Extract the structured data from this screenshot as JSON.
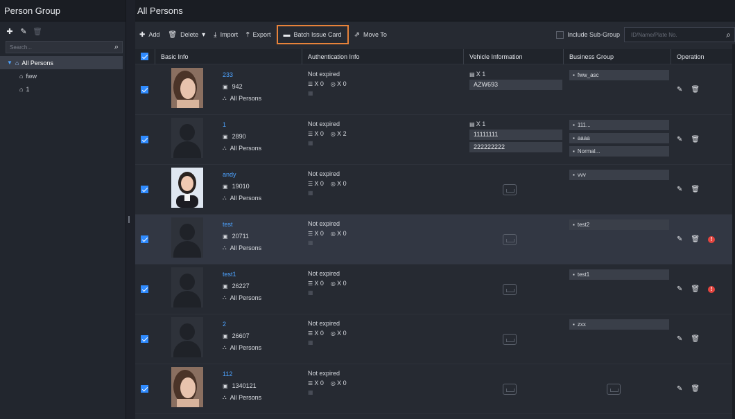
{
  "left_panel": {
    "title": "Person Group",
    "search_placeholder": "Search...",
    "tree": [
      {
        "label": "All Persons",
        "selected": true
      },
      {
        "label": "fww"
      },
      {
        "label": "1"
      }
    ]
  },
  "main": {
    "title": "All Persons",
    "toolbar": {
      "add": "Add",
      "delete": "Delete",
      "import": "Import",
      "export": "Export",
      "batch_issue_card": "Batch Issue Card",
      "move_to": "Move To",
      "include_subgroup": "Include Sub-Group",
      "search_placeholder": "ID/Name/Plate No."
    },
    "columns": [
      "Basic Info",
      "Authentication Info",
      "Vehicle Information",
      "Business Group",
      "Operation"
    ],
    "rows": [
      {
        "name": "233",
        "id": "942",
        "group": "All Persons",
        "status": "Not expired",
        "cards": "X 0",
        "fingers": "X 0",
        "veh_count": "X 1",
        "plates": [
          "AZW693"
        ],
        "biz": [
          "fww_asc"
        ],
        "photo": "woman-1"
      },
      {
        "name": "1",
        "id": "2890",
        "group": "All Persons",
        "status": "Not expired",
        "cards": "X 0",
        "fingers": "X 2",
        "veh_count": "X 1",
        "plates": [
          "11111111",
          "222222222"
        ],
        "biz": [
          "111...",
          "aaaa",
          "Normal..."
        ],
        "photo": "default"
      },
      {
        "name": "andy",
        "id": "19010",
        "group": "All Persons",
        "status": "Not expired",
        "cards": "X 0",
        "fingers": "X 0",
        "veh_count": "",
        "plates": [],
        "biz": [
          "vvv"
        ],
        "photo": "woman-2"
      },
      {
        "name": "test",
        "id": "20711",
        "group": "All Persons",
        "status": "Not expired",
        "cards": "X 0",
        "fingers": "X 0",
        "veh_count": "",
        "plates": [],
        "biz": [
          "test2"
        ],
        "photo": "default",
        "warn": true,
        "hover": true
      },
      {
        "name": "test1",
        "id": "26227",
        "group": "All Persons",
        "status": "Not expired",
        "cards": "X 0",
        "fingers": "X 0",
        "veh_count": "",
        "plates": [],
        "biz": [
          "test1"
        ],
        "photo": "default",
        "warn": true
      },
      {
        "name": "2",
        "id": "26607",
        "group": "All Persons",
        "status": "Not expired",
        "cards": "X 0",
        "fingers": "X 0",
        "veh_count": "",
        "plates": [],
        "biz": [
          "zxx"
        ],
        "photo": "default"
      },
      {
        "name": "112",
        "id": "1340121",
        "group": "All Persons",
        "status": "Not expired",
        "cards": "X 0",
        "fingers": "X 0",
        "veh_count": "",
        "plates": [],
        "biz": [],
        "photo": "woman-1"
      }
    ]
  },
  "colors": {
    "accent": "#2f8bff",
    "link": "#4da3ff",
    "highlight_border": "#e8833a",
    "warn": "#e5453f"
  }
}
